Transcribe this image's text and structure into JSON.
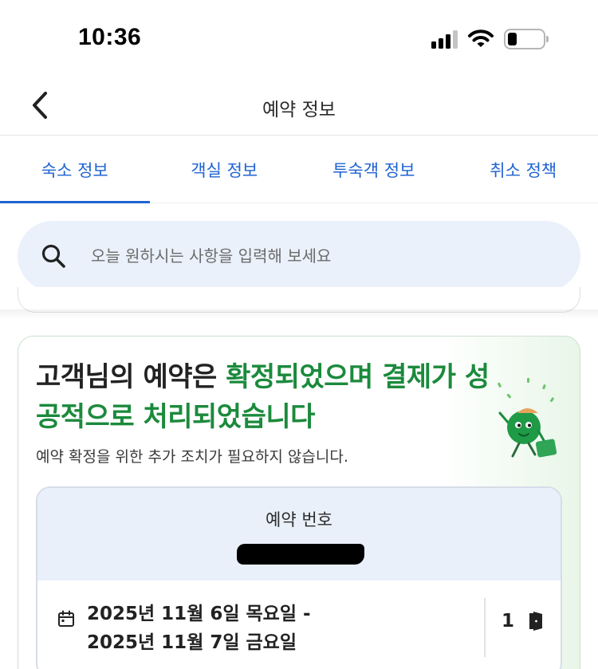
{
  "status_bar": {
    "time": "10:36"
  },
  "header": {
    "title": "예약 정보"
  },
  "tabs": [
    {
      "label": "숙소 정보",
      "active": true
    },
    {
      "label": "객실 정보",
      "active": false
    },
    {
      "label": "투숙객 정보",
      "active": false
    },
    {
      "label": "취소 정책",
      "active": false
    }
  ],
  "search": {
    "placeholder": "오늘 원하시는 사항을 입력해 보세요"
  },
  "confirmation": {
    "title_prefix": "고객님의 예약은 ",
    "title_highlight": "확정되었으며 결제가 성공적으로 처리되었습니다",
    "subtitle": "예약 확정을 위한 추가 조치가 필요하지 않습니다."
  },
  "booking": {
    "number_label": "예약 번호",
    "date_line1": "2025년 11월 6일 목요일 -",
    "date_line2": "2025년 11월 7일 금요일",
    "room_count": "1"
  },
  "colors": {
    "accent_blue": "#1f63d2",
    "success_green": "#1b8a3c",
    "search_bg": "#eaf1fb"
  }
}
